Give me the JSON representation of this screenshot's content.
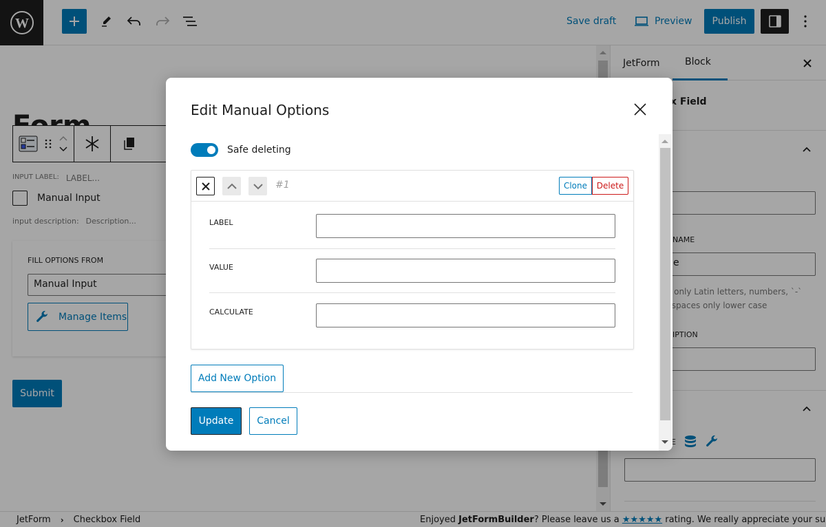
{
  "topbar": {
    "logo_icon": "wordpress-logo-icon",
    "inserter_icon": "plus-icon",
    "tools_icon": "pen-icon",
    "undo_icon": "undo-icon",
    "redo_icon": "redo-icon",
    "list_view_icon": "list-view-icon",
    "save_draft_label": "Save draft",
    "preview_label": "Preview",
    "preview_icon": "desktop-icon",
    "publish_label": "Publish",
    "settings_icon": "sidebar-toggle-icon",
    "more_icon": "more-vertical-icon"
  },
  "canvas": {
    "form_title": "Form",
    "block_toolbar": {
      "block_icon": "checkbox-field-icon",
      "drag_icon": "drag-handle-icon",
      "mover_icon": "move-up-down-icon",
      "required_icon": "asterisk-icon",
      "copy_icon": "duplicate-icon"
    },
    "input_label_caption": "INPUT LABEL:",
    "input_label_placeholder": "LABEL...",
    "checkbox_option_label": "Manual Input",
    "input_description_caption": "input description:",
    "input_description_placeholder": "Description...",
    "fill_options_label": "FILL OPTIONS FROM",
    "fill_options_value": "Manual Input",
    "manage_items_label": "Manage Items",
    "submit_label": "Submit"
  },
  "sidebar": {
    "tabs": [
      {
        "label": "JetForm",
        "active": false
      },
      {
        "label": "Block",
        "active": true
      }
    ],
    "block_name": "Checkbox Field",
    "visible_name_label_fragment": "NAME",
    "name_value_fragment": "e",
    "name_help_line1_fragment": "ain only Latin letters, numbers, `-`",
    "name_help_line2_fragment": "no spaces only lower case",
    "description_label_fragment": "IPTION",
    "default_value_label_fragment": "UE"
  },
  "footer": {
    "breadcrumb": [
      "JetForm",
      "Checkbox Field"
    ],
    "note_prefix": "Enjoyed ",
    "note_brand": "JetFormBuilder",
    "note_middle": "? Please leave us a ",
    "note_stars": "★★★★★",
    "note_suffix": " rating. We really appreciate your suppo"
  },
  "modal": {
    "title": "Edit Manual Options",
    "close_icon": "close-icon",
    "safe_deleting_label": "Safe deleting",
    "safe_deleting_on": true,
    "options": [
      {
        "index_label": "#1",
        "clone_label": "Clone",
        "delete_label": "Delete",
        "fields": [
          {
            "label": "LABEL",
            "value": ""
          },
          {
            "label": "VALUE",
            "value": ""
          },
          {
            "label": "CALCULATE",
            "value": ""
          }
        ]
      }
    ],
    "add_option_label": "Add New Option",
    "update_label": "Update",
    "cancel_label": "Cancel"
  },
  "colors": {
    "accent": "#007cba",
    "danger": "#cc1818",
    "dark": "#1e1e1e"
  }
}
